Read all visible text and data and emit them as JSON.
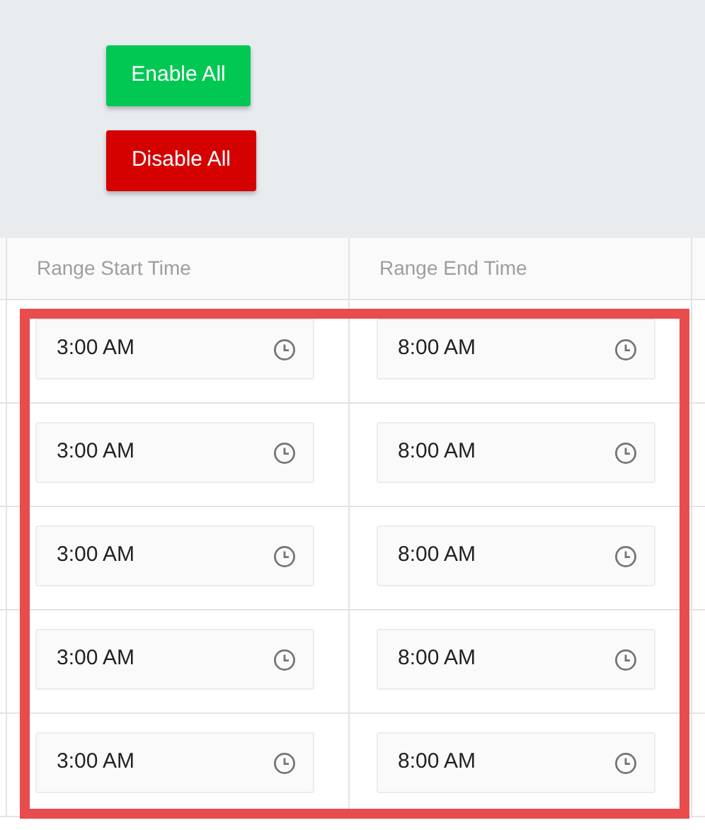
{
  "buttons": [
    {
      "label": "Enable All",
      "kind": "enable"
    },
    {
      "label": "Disable All",
      "kind": "disable"
    }
  ],
  "table": {
    "columns": [
      "Range Start Time",
      "Range End Time"
    ],
    "rows": [
      {
        "start": "3:00 AM",
        "end": "8:00 AM"
      },
      {
        "start": "3:00 AM",
        "end": "8:00 AM"
      },
      {
        "start": "3:00 AM",
        "end": "8:00 AM"
      },
      {
        "start": "3:00 AM",
        "end": "8:00 AM"
      },
      {
        "start": "3:00 AM",
        "end": "8:00 AM"
      }
    ]
  }
}
